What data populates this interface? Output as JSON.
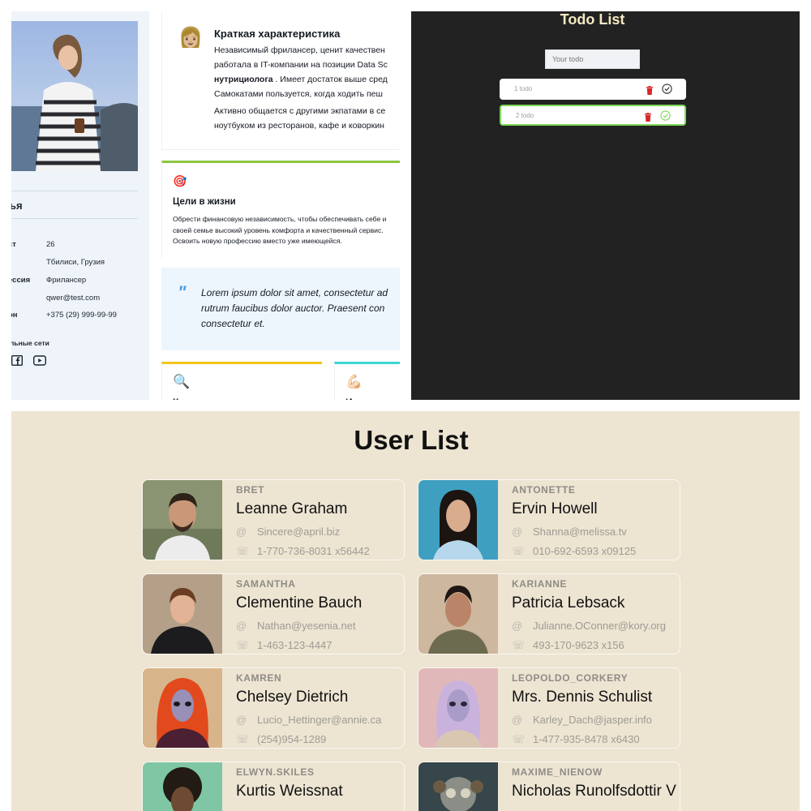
{
  "profile": {
    "name_partial": "ья",
    "rows": [
      {
        "key": "ст",
        "value": "26"
      },
      {
        "key": "",
        "value": "Тбилиси, Грузия"
      },
      {
        "key": "ессия",
        "value": "Фрилансер"
      },
      {
        "key": "",
        "value": "qwer@test.com"
      },
      {
        "key": "он",
        "value": "+375 (29) 999-99-99"
      }
    ],
    "social_title": "льные сети",
    "brief": {
      "title": "Краткая характеристика",
      "line1": "Независимый фрилансер, ценит качествен",
      "line2": "работала в IT-компании на позиции Data Sc",
      "line3_bold": "нутрициолога",
      "line3_rest": " . Имеет достаток выше сред",
      "line4": "Самокатами пользуется, когда ходить пеш",
      "line5": "Активно общается с другими экпатами в се",
      "line6": "ноутбуком из ресторанов, кафе и коворкин"
    },
    "goals": {
      "title": "Цели в жизни",
      "text": "Обрести финансовую независимость, чтобы обеспечивать себе и своей семье высокий уровень комфорта и качественный сервис. Освоить новую профессию вместо уже имеющейся."
    },
    "quote": {
      "line1": "Lorem ipsum dolor sit amet, consectetur ad",
      "line2": "rutrum faucibus dolor auctor. Praesent con",
      "line3": "consectetur et."
    },
    "mini_cards": [
      {
        "letter": "К"
      },
      {
        "letter": "И"
      }
    ]
  },
  "todo": {
    "title": "Todo List",
    "input_placeholder": "Your todo",
    "items": [
      {
        "text": "1 todo",
        "done": false
      },
      {
        "text": "2 todo",
        "done": true
      }
    ],
    "colors": {
      "accent_done": "#7ed957",
      "trash": "#d62828",
      "title": "#f4e9c3"
    }
  },
  "users": {
    "title": "User List",
    "list": [
      {
        "username": "BRET",
        "name": "Leanne Graham",
        "email": "Sincere@april.biz",
        "phone": "1-770-736-8031 x56442"
      },
      {
        "username": "ANTONETTE",
        "name": "Ervin Howell",
        "email": "Shanna@melissa.tv",
        "phone": "010-692-6593 x09125"
      },
      {
        "username": "SAMANTHA",
        "name": "Clementine Bauch",
        "email": "Nathan@yesenia.net",
        "phone": "1-463-123-4447"
      },
      {
        "username": "KARIANNE",
        "name": "Patricia Lebsack",
        "email": "Julianne.OConner@kory.org",
        "phone": "493-170-9623 x156"
      },
      {
        "username": "KAMREN",
        "name": "Chelsey Dietrich",
        "email": "Lucio_Hettinger@annie.ca",
        "phone": "(254)954-1289"
      },
      {
        "username": "LEOPOLDO_CORKERY",
        "name": "Mrs. Dennis Schulist",
        "email": "Karley_Dach@jasper.info",
        "phone": "1-477-935-8478 x6430"
      },
      {
        "username": "ELWYN.SKILES",
        "name": "Kurtis Weissnat",
        "email": "",
        "phone": ""
      },
      {
        "username": "MAXIME_NIENOW",
        "name": "Nicholas Runolfsdottir V",
        "email": "",
        "phone": ""
      }
    ]
  }
}
